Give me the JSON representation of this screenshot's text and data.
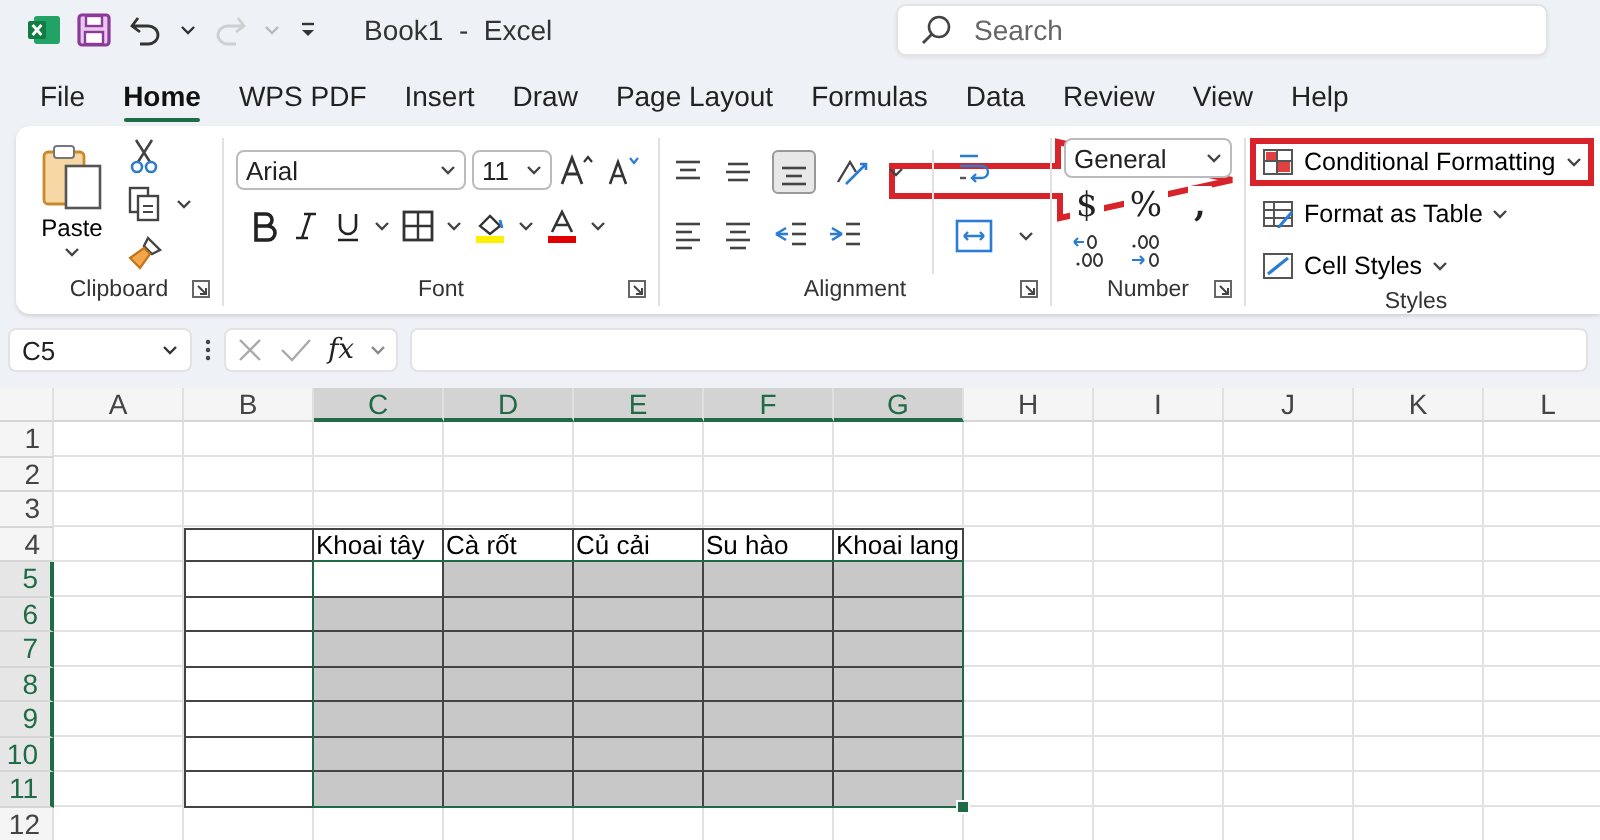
{
  "title_bar": {
    "document_title": "Book1  -  Excel",
    "quick_access": [
      {
        "kind": "save",
        "disabled": false
      },
      {
        "kind": "undo",
        "disabled": false
      },
      {
        "kind": "redo",
        "disabled": true
      }
    ],
    "search": {
      "placeholder": "Search"
    }
  },
  "tabs": [
    {
      "label": "File",
      "selected": false
    },
    {
      "label": "Home",
      "selected": true
    },
    {
      "label": "WPS PDF",
      "selected": false
    },
    {
      "label": "Insert",
      "selected": false
    },
    {
      "label": "Draw",
      "selected": false
    },
    {
      "label": "Page Layout",
      "selected": false
    },
    {
      "label": "Formulas",
      "selected": false
    },
    {
      "label": "Data",
      "selected": false
    },
    {
      "label": "Review",
      "selected": false
    },
    {
      "label": "View",
      "selected": false
    },
    {
      "label": "Help",
      "selected": false
    }
  ],
  "ribbon": {
    "clipboard": {
      "label": "Clipboard",
      "paste_label": "Paste"
    },
    "font": {
      "label": "Font",
      "font_name": "Arial",
      "font_size": "11"
    },
    "alignment": {
      "label": "Alignment"
    },
    "number": {
      "label": "Number",
      "format": "General",
      "currency_symbol": "$",
      "percent_symbol": "%",
      "comma_symbol": ","
    },
    "styles": {
      "label": "Styles",
      "items": [
        {
          "label": "Conditional Formatting",
          "highlighted": true
        },
        {
          "label": "Format as Table",
          "highlighted": false
        },
        {
          "label": "Cell Styles",
          "highlighted": false
        }
      ]
    },
    "callout_arrow": true
  },
  "formula_bar": {
    "name_box": "C5",
    "function_label": "fx"
  },
  "sheet": {
    "columns": [
      {
        "label": "A",
        "selected": false
      },
      {
        "label": "B",
        "selected": false
      },
      {
        "label": "C",
        "selected": true
      },
      {
        "label": "D",
        "selected": true
      },
      {
        "label": "E",
        "selected": true
      },
      {
        "label": "F",
        "selected": true
      },
      {
        "label": "G",
        "selected": true
      },
      {
        "label": "H",
        "selected": false
      },
      {
        "label": "I",
        "selected": false
      },
      {
        "label": "J",
        "selected": false
      },
      {
        "label": "K",
        "selected": false
      },
      {
        "label": "L",
        "selected": false
      }
    ],
    "rows": [
      {
        "label": "1",
        "selected": false
      },
      {
        "label": "2",
        "selected": false
      },
      {
        "label": "3",
        "selected": false
      },
      {
        "label": "4",
        "selected": false
      },
      {
        "label": "5",
        "selected": true
      },
      {
        "label": "6",
        "selected": true
      },
      {
        "label": "7",
        "selected": true
      },
      {
        "label": "8",
        "selected": true
      },
      {
        "label": "9",
        "selected": true
      },
      {
        "label": "10",
        "selected": true
      },
      {
        "label": "11",
        "selected": true
      },
      {
        "label": "12",
        "selected": false
      }
    ],
    "table": {
      "bordered": true,
      "rows": [
        {
          "cells": [
            {
              "shaded": false
            },
            {
              "shaded": false,
              "text": "Khoai tây"
            },
            {
              "shaded": false,
              "text": "Cà rốt"
            },
            {
              "shaded": false,
              "text": "Củ cải"
            },
            {
              "shaded": false,
              "text": "Su hào"
            },
            {
              "shaded": false,
              "text": "Khoai lang"
            }
          ]
        },
        {
          "cells": [
            {
              "shaded": false
            },
            {
              "shaded": false
            },
            {
              "shaded": true
            },
            {
              "shaded": true
            },
            {
              "shaded": true
            },
            {
              "shaded": true
            }
          ]
        },
        {
          "cells": [
            {
              "shaded": false
            },
            {
              "shaded": true
            },
            {
              "shaded": true
            },
            {
              "shaded": true
            },
            {
              "shaded": true
            },
            {
              "shaded": true
            }
          ]
        },
        {
          "cells": [
            {
              "shaded": false
            },
            {
              "shaded": true
            },
            {
              "shaded": true
            },
            {
              "shaded": true
            },
            {
              "shaded": true
            },
            {
              "shaded": true
            }
          ]
        },
        {
          "cells": [
            {
              "shaded": false
            },
            {
              "shaded": true
            },
            {
              "shaded": true
            },
            {
              "shaded": true
            },
            {
              "shaded": true
            },
            {
              "shaded": true
            }
          ]
        },
        {
          "cells": [
            {
              "shaded": false
            },
            {
              "shaded": true
            },
            {
              "shaded": true
            },
            {
              "shaded": true
            },
            {
              "shaded": true
            },
            {
              "shaded": true
            }
          ]
        },
        {
          "cells": [
            {
              "shaded": false
            },
            {
              "shaded": true
            },
            {
              "shaded": true
            },
            {
              "shaded": true
            },
            {
              "shaded": true
            },
            {
              "shaded": true
            }
          ]
        },
        {
          "cells": [
            {
              "shaded": false
            },
            {
              "shaded": true
            },
            {
              "shaded": true
            },
            {
              "shaded": true
            },
            {
              "shaded": true
            },
            {
              "shaded": true
            }
          ]
        }
      ]
    }
  }
}
